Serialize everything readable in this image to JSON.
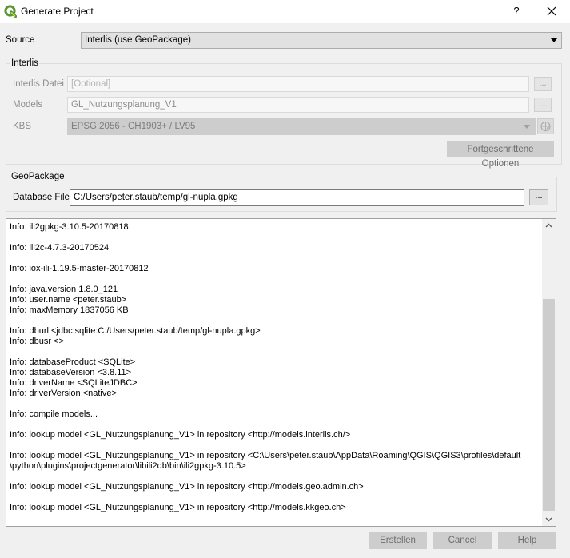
{
  "window": {
    "title": "Generate Project",
    "help_symbol": "?"
  },
  "source": {
    "label": "Source",
    "value": "Interlis (use GeoPackage)"
  },
  "interlis": {
    "group_title": "Interlis",
    "file_label": "Interlis Datei",
    "file_placeholder": "[Optional]",
    "file_browse": "...",
    "models_label": "Models",
    "models_value": "GL_Nutzungsplanung_V1",
    "models_browse": "...",
    "kbs_label": "KBS",
    "kbs_value": "EPSG:2056 - CH1903+ / LV95",
    "advanced_button": "Fortgeschrittene Optionen"
  },
  "geopackage": {
    "group_title": "GeoPackage",
    "db_label": "Database File",
    "db_value": "C:/Users/peter.staub/temp/gl-nupla.gpkg",
    "db_browse": "..."
  },
  "log": {
    "lines": [
      "Info: ili2gpkg-3.10.5-20170818",
      "",
      "Info: ili2c-4.7.3-20170524",
      "",
      "Info: iox-ili-1.19.5-master-20170812",
      "",
      "Info: java.version 1.8.0_121",
      "Info: user.name <peter.staub>",
      "Info: maxMemory 1837056 KB",
      "",
      "Info: dburl <jdbc:sqlite:C:/Users/peter.staub/temp/gl-nupla.gpkg>",
      "Info: dbusr <>",
      "",
      "Info: databaseProduct <SQLite>",
      "Info: databaseVersion <3.8.11>",
      "Info: driverName <SQLiteJDBC>",
      "Info: driverVersion <native>",
      "",
      "Info: compile models...",
      "",
      "Info: lookup model <GL_Nutzungsplanung_V1> in repository <http://models.interlis.ch/>",
      "",
      "Info: lookup model <GL_Nutzungsplanung_V1> in repository <C:\\Users\\peter.staub\\AppData\\Roaming\\QGIS\\QGIS3\\profiles\\default",
      "\\python\\plugins\\projectgenerator\\libili2db\\bin\\ili2gpkg-3.10.5>",
      "",
      "Info: lookup model <GL_Nutzungsplanung_V1> in repository <http://models.geo.admin.ch>",
      "",
      "Info: lookup model <GL_Nutzungsplanung_V1> in repository <http://models.kkgeo.ch>"
    ]
  },
  "buttons": {
    "create": "Erstellen",
    "cancel": "Cancel",
    "help": "Help"
  },
  "colors": {
    "qgis_green": "#589632",
    "qgis_yellow": "#f0e64a"
  }
}
